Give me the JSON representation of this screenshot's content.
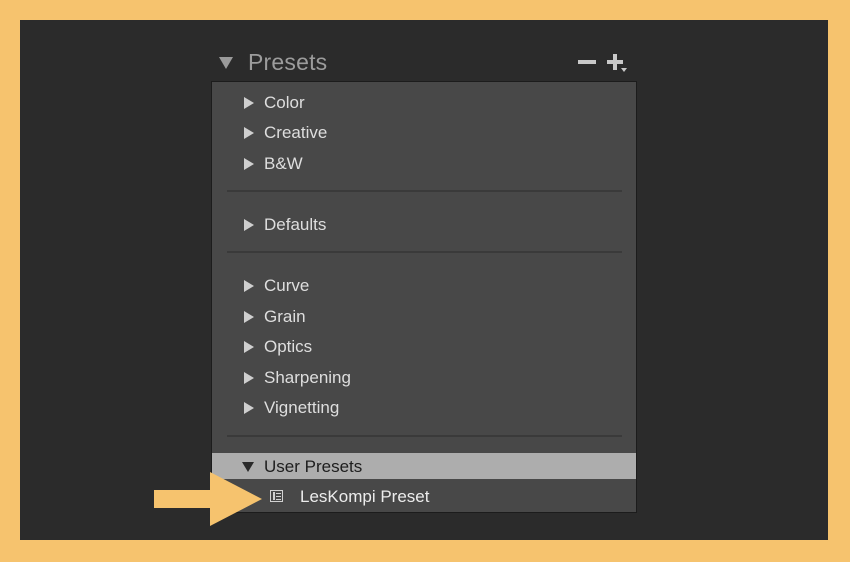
{
  "panel": {
    "title": "Presets",
    "minus_icon": "minus-icon",
    "plus_icon": "plus-dropdown-icon"
  },
  "groups": [
    {
      "label": "Color",
      "expanded": false
    },
    {
      "label": "Creative",
      "expanded": false
    },
    {
      "label": "B&W",
      "expanded": false
    },
    {
      "label": "Defaults",
      "expanded": false
    },
    {
      "label": "Curve",
      "expanded": false
    },
    {
      "label": "Grain",
      "expanded": false
    },
    {
      "label": "Optics",
      "expanded": false
    },
    {
      "label": "Sharpening",
      "expanded": false
    },
    {
      "label": "Vignetting",
      "expanded": false
    }
  ],
  "user_presets": {
    "label": "User Presets",
    "expanded": true,
    "items": [
      {
        "label": "LesKompi Preset",
        "icon": "preset-icon"
      }
    ]
  },
  "annotation": {
    "icon": "arrow-pointer",
    "color": "#f6c36e"
  },
  "colors": {
    "frame": "#f6c36e",
    "app_background": "#2b2b2b",
    "panel_background": "#484848",
    "selected_row": "#adadad"
  }
}
